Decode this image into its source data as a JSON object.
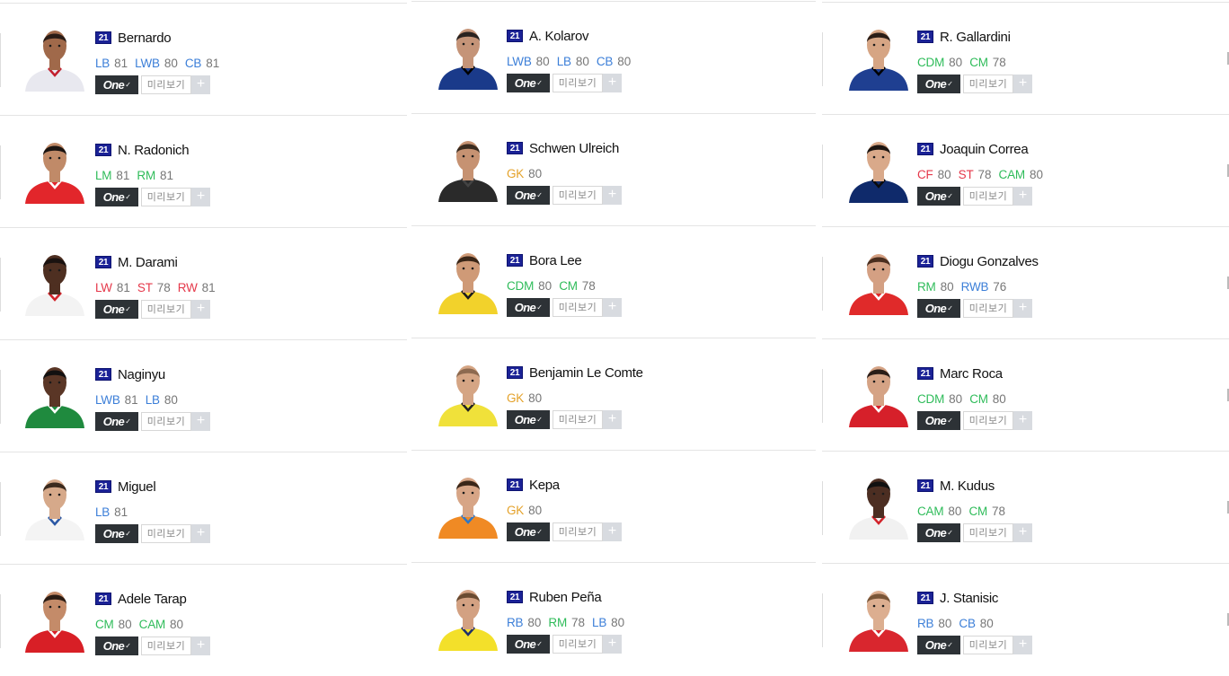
{
  "columns": [
    {
      "players": [
        {
          "name": "Bernardo",
          "season": "21",
          "positions": [
            {
              "pos": "LB",
              "ovr": "81",
              "group": "def"
            },
            {
              "pos": "LWB",
              "ovr": "80",
              "group": "def"
            },
            {
              "pos": "CB",
              "ovr": "81",
              "group": "def"
            }
          ],
          "kit": "#e8e8ef",
          "kitTrim": "#c21f2e",
          "skin": "#a0694a",
          "hair": "#2a1c16"
        },
        {
          "name": "N. Radonich",
          "season": "21",
          "positions": [
            {
              "pos": "LM",
              "ovr": "81",
              "group": "mid"
            },
            {
              "pos": "RM",
              "ovr": "81",
              "group": "mid"
            }
          ],
          "kit": "#e2262b",
          "kitTrim": "#ffffff",
          "skin": "#c08a68",
          "hair": "#1b1411"
        },
        {
          "name": "M. Darami",
          "season": "21",
          "positions": [
            {
              "pos": "LW",
              "ovr": "81",
              "group": "att"
            },
            {
              "pos": "ST",
              "ovr": "78",
              "group": "att"
            },
            {
              "pos": "RW",
              "ovr": "81",
              "group": "att"
            }
          ],
          "kit": "#f3f3f3",
          "kitTrim": "#d2232a",
          "skin": "#4e2f21",
          "hair": "#1a1210"
        },
        {
          "name": "Naginyu",
          "season": "21",
          "positions": [
            {
              "pos": "LWB",
              "ovr": "81",
              "group": "def"
            },
            {
              "pos": "LB",
              "ovr": "80",
              "group": "def"
            }
          ],
          "kit": "#1f8a3e",
          "kitTrim": "#ffffff",
          "skin": "#5a3626",
          "hair": "#121010"
        },
        {
          "name": "Miguel",
          "season": "21",
          "positions": [
            {
              "pos": "LB",
              "ovr": "81",
              "group": "def"
            }
          ],
          "kit": "#f4f4f4",
          "kitTrim": "#2b58a5",
          "skin": "#d6a98a",
          "hair": "#3b2a1e"
        },
        {
          "name": "Adele Tarap",
          "season": "21",
          "positions": [
            {
              "pos": "CM",
              "ovr": "80",
              "group": "mid"
            },
            {
              "pos": "CAM",
              "ovr": "80",
              "group": "mid"
            }
          ],
          "kit": "#d81f26",
          "kitTrim": "#ffffff",
          "skin": "#c48b69",
          "hair": "#2b1c14"
        }
      ]
    },
    {
      "players": [
        {
          "name": "A. Kolarov",
          "season": "21",
          "positions": [
            {
              "pos": "LWB",
              "ovr": "80",
              "group": "def"
            },
            {
              "pos": "LB",
              "ovr": "80",
              "group": "def"
            },
            {
              "pos": "CB",
              "ovr": "80",
              "group": "def"
            }
          ],
          "kit": "#1a3a8a",
          "kitTrim": "#000000",
          "skin": "#c59478",
          "hair": "#2a2320"
        },
        {
          "name": "Schwen Ulreich",
          "season": "21",
          "positions": [
            {
              "pos": "GK",
              "ovr": "80",
              "group": "gk"
            }
          ],
          "kit": "#2a2a2a",
          "kitTrim": "#444",
          "skin": "#c69272",
          "hair": "#3a2b1f"
        },
        {
          "name": "Bora Lee",
          "season": "21",
          "positions": [
            {
              "pos": "CDM",
              "ovr": "80",
              "group": "mid"
            },
            {
              "pos": "CM",
              "ovr": "78",
              "group": "mid"
            }
          ],
          "kit": "#f2d22b",
          "kitTrim": "#1b1b1b",
          "skin": "#cf9a77",
          "hair": "#3a2617"
        },
        {
          "name": "Benjamin Le Comte",
          "season": "21",
          "positions": [
            {
              "pos": "GK",
              "ovr": "80",
              "group": "gk"
            }
          ],
          "kit": "#f0e13a",
          "kitTrim": "#222",
          "skin": "#d5a584",
          "hair": "#8d6a50"
        },
        {
          "name": "Kepa",
          "season": "21",
          "positions": [
            {
              "pos": "GK",
              "ovr": "80",
              "group": "gk"
            }
          ],
          "kit": "#f08a24",
          "kitTrim": "#2e77c7",
          "skin": "#d7a586",
          "hair": "#3a2618"
        },
        {
          "name": "Ruben Peña",
          "season": "21",
          "positions": [
            {
              "pos": "RB",
              "ovr": "80",
              "group": "def"
            },
            {
              "pos": "RM",
              "ovr": "78",
              "group": "mid"
            },
            {
              "pos": "LB",
              "ovr": "80",
              "group": "def"
            }
          ],
          "kit": "#f3e02a",
          "kitTrim": "#1e2f6b",
          "skin": "#d3a182",
          "hair": "#6a4b31"
        }
      ]
    },
    {
      "players": [
        {
          "name": "R. Gallardini",
          "season": "21",
          "positions": [
            {
              "pos": "CDM",
              "ovr": "80",
              "group": "mid"
            },
            {
              "pos": "CM",
              "ovr": "78",
              "group": "mid"
            }
          ],
          "kit": "#1f3f91",
          "kitTrim": "#000000",
          "skin": "#d6a584",
          "hair": "#2b1d16"
        },
        {
          "name": "Joaquin Correa",
          "season": "21",
          "positions": [
            {
              "pos": "CF",
              "ovr": "80",
              "group": "att"
            },
            {
              "pos": "ST",
              "ovr": "78",
              "group": "att"
            },
            {
              "pos": "CAM",
              "ovr": "80",
              "group": "mid"
            }
          ],
          "kit": "#0f2a6b",
          "kitTrim": "#0a0a0a",
          "skin": "#d9a98a",
          "hair": "#1d1511"
        },
        {
          "name": "Diogu Gonzalves",
          "season": "21",
          "positions": [
            {
              "pos": "RM",
              "ovr": "80",
              "group": "mid"
            },
            {
              "pos": "RWB",
              "ovr": "76",
              "group": "def"
            }
          ],
          "kit": "#e02a2a",
          "kitTrim": "#ffffff",
          "skin": "#d4a083",
          "hair": "#4a2e1f"
        },
        {
          "name": "Marc Roca",
          "season": "21",
          "positions": [
            {
              "pos": "CDM",
              "ovr": "80",
              "group": "mid"
            },
            {
              "pos": "CM",
              "ovr": "80",
              "group": "mid"
            }
          ],
          "kit": "#d6202a",
          "kitTrim": "#ffffff",
          "skin": "#d5a385",
          "hair": "#2a1d17"
        },
        {
          "name": "M. Kudus",
          "season": "21",
          "positions": [
            {
              "pos": "CAM",
              "ovr": "80",
              "group": "mid"
            },
            {
              "pos": "CM",
              "ovr": "78",
              "group": "mid"
            }
          ],
          "kit": "#f1f1f1",
          "kitTrim": "#d2232a",
          "skin": "#4c2e22",
          "hair": "#111"
        },
        {
          "name": "J. Stanisic",
          "season": "21",
          "positions": [
            {
              "pos": "RB",
              "ovr": "80",
              "group": "def"
            },
            {
              "pos": "CB",
              "ovr": "80",
              "group": "def"
            }
          ],
          "kit": "#d9262e",
          "kitTrim": "#ffffff",
          "skin": "#dcae90",
          "hair": "#7a5638"
        }
      ]
    }
  ],
  "buttons": {
    "one_label": "One",
    "preview_label": "미리보기",
    "add_label": "+"
  },
  "icons": {
    "season_badge": "season-badge-icon",
    "add": "plus-icon"
  },
  "colors": {
    "def": "#3c7fd8",
    "mid": "#2fbc5a",
    "att": "#e5384a",
    "gk": "#e4a22a",
    "season_badge": "#1b2296",
    "one_button": "#2d3236"
  }
}
